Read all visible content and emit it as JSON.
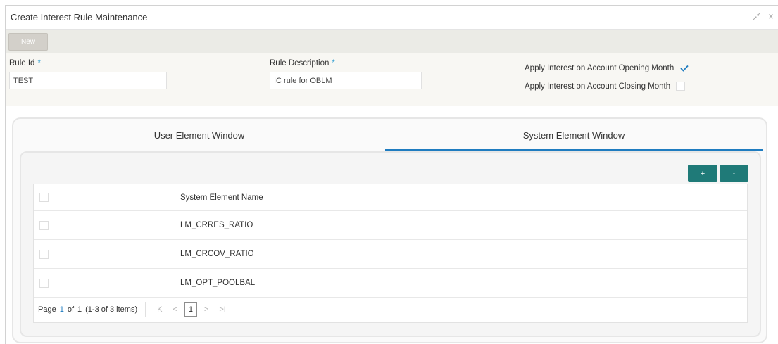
{
  "window": {
    "title": "Create Interest Rule Maintenance",
    "controls": {
      "minimize_icon": "collapse-arrows-icon",
      "close_label": "×"
    }
  },
  "toolbar": {
    "new_label": "New"
  },
  "form": {
    "rule_id": {
      "label": "Rule Id",
      "required_mark": "*",
      "value": "TEST"
    },
    "rule_description": {
      "label": "Rule Description",
      "required_mark": "*",
      "value": "IC rule for OBLM"
    },
    "apply_opening": {
      "label": "Apply Interest on Account Opening Month",
      "checked": true
    },
    "apply_closing": {
      "label": "Apply Interest on Account Closing Month",
      "checked": false
    }
  },
  "tabs": [
    {
      "label": "User Element Window",
      "active": false
    },
    {
      "label": "System Element Window",
      "active": true
    }
  ],
  "grid": {
    "add_label": "+",
    "remove_label": "-",
    "header": "System Element Name",
    "rows": [
      {
        "name": "LM_CRRES_RATIO",
        "selected": false
      },
      {
        "name": "LM_CRCOV_RATIO",
        "selected": false
      },
      {
        "name": "LM_OPT_POOLBAL",
        "selected": false
      }
    ],
    "pager": {
      "page_label": "Page",
      "current_page": "1",
      "of_label": "of",
      "total_pages": "1",
      "items_summary": "(1-3 of 3 items)",
      "first_label": "K",
      "prev_label": "<",
      "page_button": "1",
      "next_label": ">",
      "last_label": ">I"
    }
  },
  "colors": {
    "accent": "#1f7cc0",
    "required": "#3aa3d3",
    "grid_button": "#1f7a78"
  }
}
